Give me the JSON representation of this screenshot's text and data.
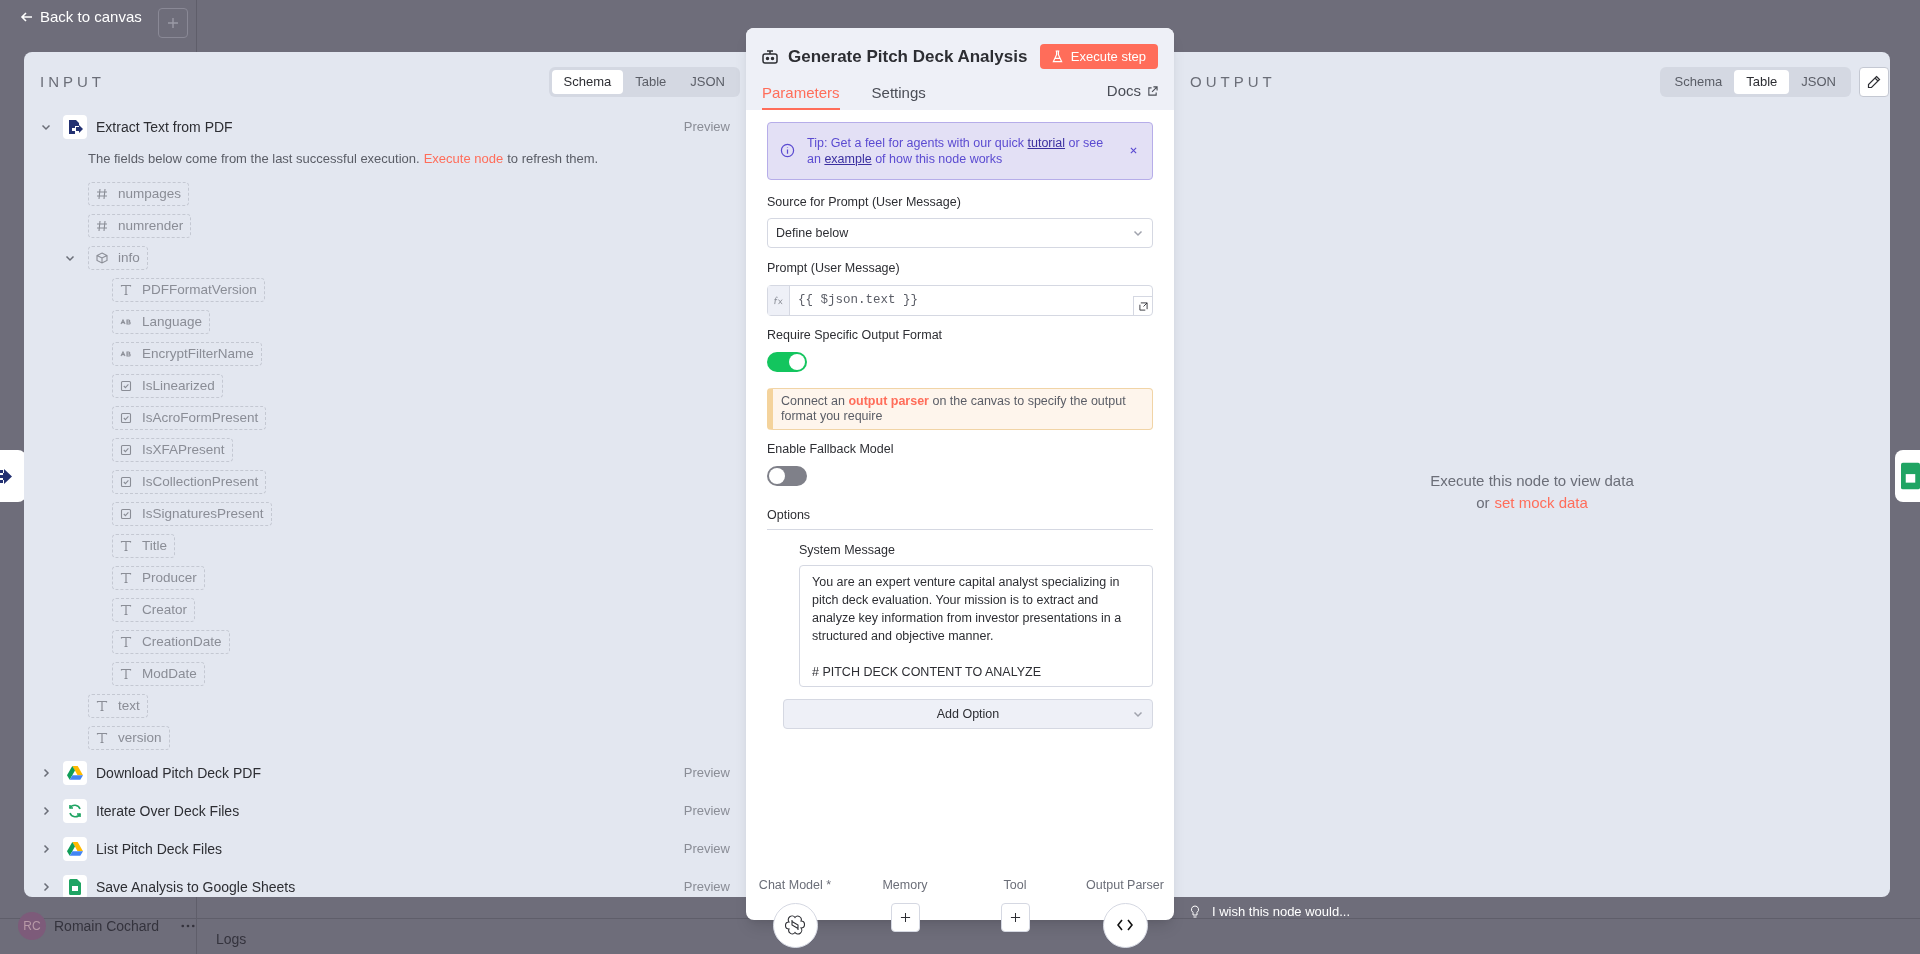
{
  "top_bar": {
    "back_link": "Back to canvas"
  },
  "background": {
    "user_initials": "RC",
    "user_name": "Romain Cochard",
    "logs_label": "Logs"
  },
  "input_panel": {
    "title": "INPUT",
    "view_tabs": [
      {
        "label": "Schema",
        "selected": true
      },
      {
        "label": "Table",
        "selected": false
      },
      {
        "label": "JSON",
        "selected": false
      }
    ],
    "nodes": [
      {
        "name": "Extract Text from PDF",
        "kind": "pdf",
        "expanded": true,
        "preview": "Preview",
        "notice": [
          {
            "kind": "text",
            "text": "The fields below come from the last successful execution."
          },
          {
            "kind": "link",
            "text": "Execute node"
          },
          {
            "kind": "text",
            "text": "to refresh them."
          }
        ],
        "fields": [
          {
            "name": "numpages",
            "kind": "number"
          },
          {
            "name": "numrender",
            "kind": "number"
          },
          {
            "name": "info",
            "kind": "object",
            "expanded": true,
            "children": [
              {
                "name": "PDFFormatVersion",
                "kind": "string"
              },
              {
                "name": "Language",
                "kind": "text"
              },
              {
                "name": "EncryptFilterName",
                "kind": "text"
              },
              {
                "name": "IsLinearized",
                "kind": "boolean"
              },
              {
                "name": "IsAcroFormPresent",
                "kind": "boolean"
              },
              {
                "name": "IsXFAPresent",
                "kind": "boolean"
              },
              {
                "name": "IsCollectionPresent",
                "kind": "boolean"
              },
              {
                "name": "IsSignaturesPresent",
                "kind": "boolean"
              },
              {
                "name": "Title",
                "kind": "string"
              },
              {
                "name": "Producer",
                "kind": "string"
              },
              {
                "name": "Creator",
                "kind": "string"
              },
              {
                "name": "CreationDate",
                "kind": "string"
              },
              {
                "name": "ModDate",
                "kind": "string"
              }
            ]
          },
          {
            "name": "text",
            "kind": "string"
          },
          {
            "name": "version",
            "kind": "string"
          }
        ]
      },
      {
        "name": "Download Pitch Deck PDF",
        "kind": "drive",
        "expanded": false,
        "preview": "Preview"
      },
      {
        "name": "Iterate Over Deck Files",
        "kind": "loop",
        "expanded": false,
        "preview": "Preview"
      },
      {
        "name": "List Pitch Deck Files",
        "kind": "drive",
        "expanded": false,
        "preview": "Preview"
      },
      {
        "name": "Save Analysis to Google Sheets",
        "kind": "sheets",
        "expanded": false,
        "preview": "Preview"
      }
    ]
  },
  "node_panel": {
    "title": "Generate Pitch Deck Analysis",
    "execute_button": "Execute step",
    "tabs": [
      {
        "label": "Parameters",
        "selected": true
      },
      {
        "label": "Settings",
        "selected": false
      }
    ],
    "docs_link": "Docs",
    "tip": [
      {
        "kind": "text",
        "text": "Tip: Get a feel for agents with our quick"
      },
      {
        "kind": "link",
        "text": "tutorial"
      },
      {
        "kind": "text",
        "text": "or see an"
      },
      {
        "kind": "link",
        "text": "example"
      },
      {
        "kind": "text",
        "text": "of how this node works"
      }
    ],
    "parameters": [
      {
        "kind": "select",
        "label": "Source for Prompt (User Message)",
        "value": "Define below"
      },
      {
        "kind": "expression",
        "label": "Prompt (User Message)",
        "value": "{{ $json.text }}"
      },
      {
        "kind": "toggle",
        "label": "Require Specific Output Format",
        "on": true
      },
      {
        "kind": "notice",
        "segments": [
          {
            "kind": "text",
            "text": "Connect an"
          },
          {
            "kind": "link",
            "text": "output parser"
          },
          {
            "kind": "text",
            "text": "on the canvas to specify the output format you require"
          }
        ]
      },
      {
        "kind": "toggle",
        "label": "Enable Fallback Model",
        "on": false
      },
      {
        "kind": "section",
        "label": "Options"
      },
      {
        "kind": "textarea",
        "label": "System Message",
        "value": "You are an expert venture capital analyst specializing in pitch deck evaluation. Your mission is to extract and analyze key information from investor presentations in a structured and objective manner.\n\n# PITCH DECK CONTENT TO ANALYZE"
      },
      {
        "kind": "add_option",
        "label": "Add Option"
      }
    ],
    "connectors": [
      {
        "label": "Chat Model *",
        "kind": "model"
      },
      {
        "label": "Memory",
        "kind": "add"
      },
      {
        "label": "Tool",
        "kind": "add"
      },
      {
        "label": "Output Parser",
        "kind": "parser"
      }
    ]
  },
  "output_panel": {
    "title": "OUTPUT",
    "view_tabs": [
      {
        "label": "Schema",
        "selected": false
      },
      {
        "label": "Table",
        "selected": true
      },
      {
        "label": "JSON",
        "selected": false
      }
    ],
    "empty_message": "Execute this node to view data",
    "empty_prefix": "or",
    "mock_link": "set mock data"
  },
  "feedback": "I wish this node would..."
}
